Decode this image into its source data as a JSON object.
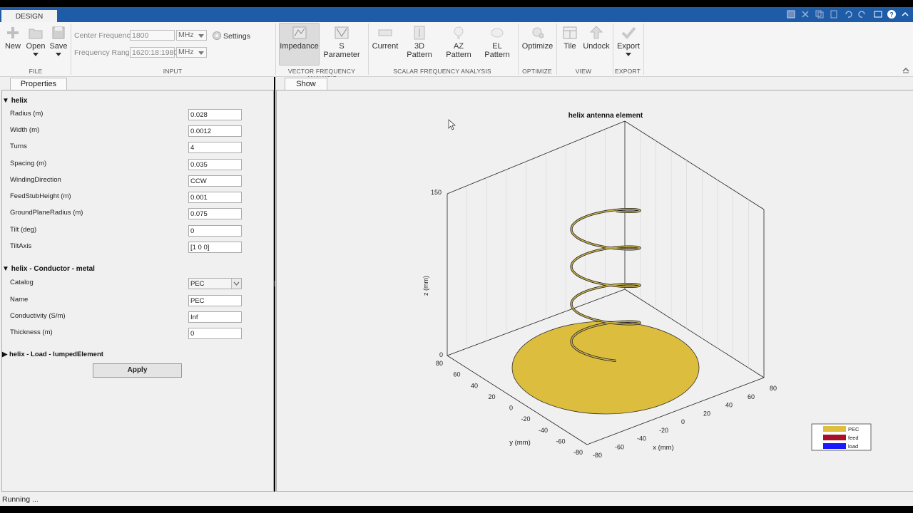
{
  "app": {
    "tab_design": "DESIGN",
    "status": "Running ..."
  },
  "ribbon": {
    "file": {
      "new": "New",
      "open": "Open",
      "save": "Save",
      "group": "FILE"
    },
    "input": {
      "center_frequency_label": "Center Frequency",
      "center_frequency_value": "1800",
      "center_frequency_unit": "MHz",
      "frequency_range_label": "Frequency Range",
      "frequency_range_value": "1620:18:1980",
      "frequency_range_unit": "MHz",
      "settings": "Settings",
      "group": "INPUT"
    },
    "vector": {
      "impedance": "Impedance",
      "s_parameter": "S Parameter",
      "group": "VECTOR FREQUENCY ANALYSIS"
    },
    "scalar": {
      "current": "Current",
      "pattern3d": "3D Pattern",
      "az": "AZ Pattern",
      "el": "EL Pattern",
      "group": "SCALAR FREQUENCY ANALYSIS"
    },
    "optimize": {
      "optimize": "Optimize",
      "group": "OPTIMIZE"
    },
    "view": {
      "tile": "Tile",
      "undock": "Undock",
      "group": "VIEW"
    },
    "export": {
      "export": "Export",
      "group": "EXPORT"
    }
  },
  "properties": {
    "tab": "Properties",
    "helix": {
      "title": "helix",
      "fields": [
        {
          "label": "Radius (m)",
          "value": "0.028"
        },
        {
          "label": "Width (m)",
          "value": "0.0012"
        },
        {
          "label": "Turns",
          "value": "4"
        },
        {
          "label": "Spacing (m)",
          "value": "0.035"
        },
        {
          "label": "WindingDirection",
          "value": "CCW"
        },
        {
          "label": "FeedStubHeight (m)",
          "value": "0.001"
        },
        {
          "label": "GroundPlaneRadius (m)",
          "value": "0.075"
        },
        {
          "label": "Tilt (deg)",
          "value": "0"
        },
        {
          "label": "TiltAxis",
          "value": "[1 0 0]"
        }
      ]
    },
    "conductor": {
      "title": "helix - Conductor - metal",
      "catalog_label": "Catalog",
      "catalog_value": "PEC",
      "fields": [
        {
          "label": "Name",
          "value": "PEC"
        },
        {
          "label": "Conductivity (S/m)",
          "value": "Inf"
        },
        {
          "label": "Thickness (m)",
          "value": "0"
        }
      ]
    },
    "load": {
      "title": "helix - Load - lumpedElement"
    },
    "apply": "Apply"
  },
  "show": {
    "tab": "Show",
    "plot_title": "helix antenna element",
    "z_label": "z (mm)",
    "y_label": "y (mm)",
    "x_label": "x (mm)",
    "z_ticks": [
      "150",
      "0"
    ],
    "y_ticks": [
      "80",
      "60",
      "40",
      "20",
      "0",
      "-20",
      "-40",
      "-60",
      "-80"
    ],
    "x_ticks": [
      "80",
      "60",
      "40",
      "20",
      "0",
      "-20",
      "-40",
      "-60",
      "-80"
    ],
    "legend": [
      {
        "name": "PEC",
        "color": "#e0bf3f"
      },
      {
        "name": "feed",
        "color": "#a8102a"
      },
      {
        "name": "load",
        "color": "#1a1aff"
      }
    ]
  },
  "colors": {
    "tabstrip": "#1f5ca8",
    "ground_plane": "#dcbd3e",
    "helix": "#c9b24a"
  }
}
